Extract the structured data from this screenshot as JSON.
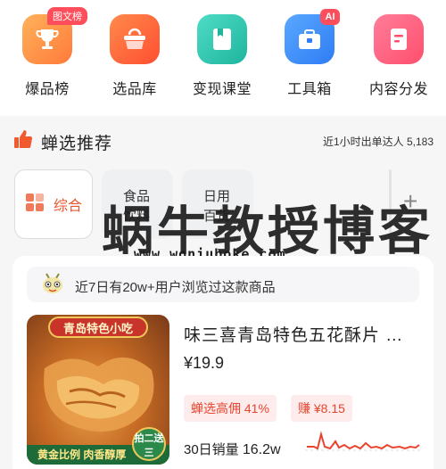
{
  "toolbar": {
    "items": [
      {
        "label": "爆品榜",
        "badge": "图文榜",
        "icon": "trophy-icon",
        "color": "#ff8a3d"
      },
      {
        "label": "选品库",
        "icon": "basket-icon",
        "color": "#ff5f3a"
      },
      {
        "label": "变现课堂",
        "icon": "book-icon",
        "color": "#2dc7b2"
      },
      {
        "label": "工具箱",
        "badge": "AI",
        "icon": "toolbox-icon",
        "color": "#3d8dff"
      },
      {
        "label": "内容分发",
        "icon": "document-icon",
        "color": "#ff5a78"
      }
    ]
  },
  "section": {
    "title": "蝉选推荐",
    "stats": "近1小时出单达人 5,183",
    "icon": "thumbs-up-icon"
  },
  "categories": {
    "active": "综合",
    "items": [
      "食品饮料",
      "日用百货"
    ],
    "more": "+"
  },
  "watermark": {
    "main": "蜗牛教授博客",
    "url": "www.woniubоke.com"
  },
  "product": {
    "browse_notice": "近7日有20w+用户浏览过这款商品",
    "image_top": "青岛特色小吃",
    "image_bottom": "黄金比例 肉香醇厚",
    "image_seal": "拍二送三",
    "title": "味三喜青岛特色五花酥片 …",
    "price": "¥19.9",
    "commission": "蝉选高佣 41%",
    "earn": "赚 ¥8.15",
    "sales_label": "30日销量",
    "sales_value": "16.2w"
  },
  "colors": {
    "accent": "#e8452e",
    "chart_line": "#e8452e"
  }
}
